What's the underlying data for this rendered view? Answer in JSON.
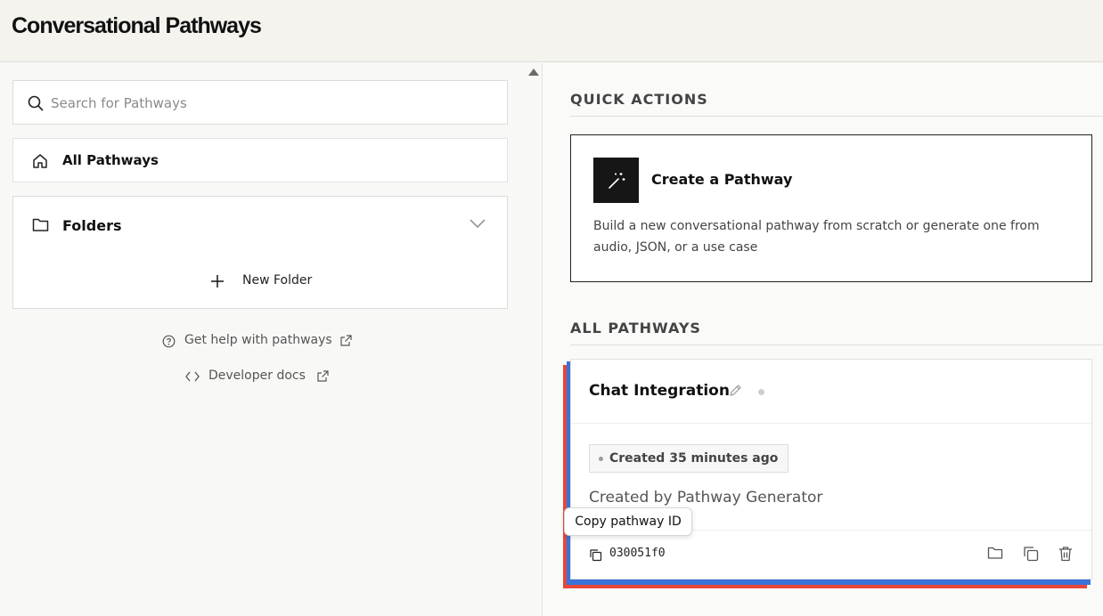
{
  "app": {
    "title": "Conversational Pathways"
  },
  "sidebar": {
    "search": {
      "placeholder": "Search for Pathways",
      "value": ""
    },
    "all_pathways_label": "All Pathways",
    "folders_label": "Folders",
    "new_folder_label": "New Folder",
    "help_link": "Get help with pathways",
    "docs_link": "Developer docs"
  },
  "main": {
    "quick_actions_title": "QUICK ACTIONS",
    "create_card": {
      "title": "Create a Pathway",
      "description": "Build a new conversational pathway from scratch or generate one from audio, JSON, or a use case"
    },
    "all_pathways_title": "ALL PATHWAYS",
    "pathways": [
      {
        "name": "Chat Integration",
        "created": "Created 35 minutes ago",
        "creator": "Created by Pathway Generator",
        "id": "030051f0"
      }
    ],
    "tooltip": "Copy pathway ID"
  },
  "colors": {
    "accent_red": "#e8473a",
    "accent_blue": "#3a73d9",
    "header_bg": "#f4f3ee",
    "icon_dark": "#161616"
  },
  "icons": [
    "search-icon",
    "home-icon",
    "folder-icon",
    "chevron-down-icon",
    "plus-icon",
    "help-circle-icon",
    "external-link-icon",
    "code-icon",
    "magic-wand-icon",
    "pencil-icon",
    "copy-icon",
    "trash-icon"
  ]
}
